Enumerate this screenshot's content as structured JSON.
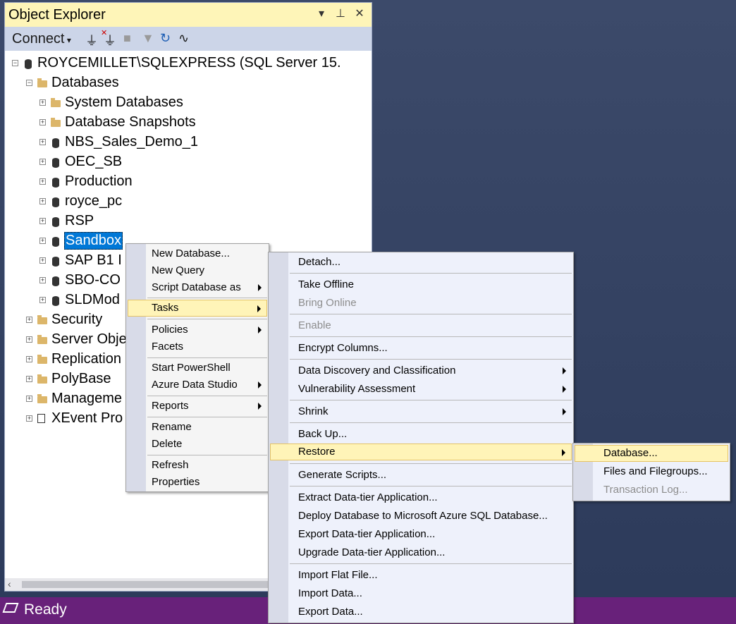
{
  "panel": {
    "title": "Object Explorer",
    "title_buttons": [
      "▾",
      "⊥",
      "✕"
    ],
    "connect_label": "Connect",
    "toolbar_icons": [
      "connect-icon",
      "disconnect-icon",
      "stop-icon",
      "filter-icon",
      "refresh-icon",
      "activity-monitor-icon"
    ]
  },
  "tree": {
    "server": "ROYCEMILLET\\SQLEXPRESS (SQL Server 15.",
    "databases": "Databases",
    "items": [
      "System Databases",
      "Database Snapshots",
      "NBS_Sales_Demo_1",
      "OEC_SB",
      "Production",
      "royce_pc",
      "RSP",
      "Sandbox",
      "SAP B1 I",
      "SBO-CO",
      "SLDMod"
    ],
    "top_items": [
      "Security",
      "Server Obje",
      "Replication",
      "PolyBase",
      "Manageme",
      "XEvent Pro"
    ]
  },
  "menu1": {
    "items": [
      {
        "label": "New Database..."
      },
      {
        "label": "New Query"
      },
      {
        "label": "Script Database as"
      },
      {
        "label": "Tasks"
      },
      {
        "label": "Policies"
      },
      {
        "label": "Facets"
      },
      {
        "label": "Start PowerShell"
      },
      {
        "label": "Azure Data Studio"
      },
      {
        "label": "Reports"
      },
      {
        "label": "Rename"
      },
      {
        "label": "Delete"
      },
      {
        "label": "Refresh"
      },
      {
        "label": "Properties"
      }
    ]
  },
  "menu2": {
    "items": [
      {
        "label": "Detach..."
      },
      {
        "label": "Take Offline"
      },
      {
        "label": "Bring Online"
      },
      {
        "label": "Enable"
      },
      {
        "label": "Encrypt Columns..."
      },
      {
        "label": "Data Discovery and Classification"
      },
      {
        "label": "Vulnerability Assessment"
      },
      {
        "label": "Shrink"
      },
      {
        "label": "Back Up..."
      },
      {
        "label": "Restore"
      },
      {
        "label": "Generate Scripts..."
      },
      {
        "label": "Extract Data-tier Application..."
      },
      {
        "label": "Deploy Database to Microsoft Azure SQL Database..."
      },
      {
        "label": "Export Data-tier Application..."
      },
      {
        "label": "Upgrade Data-tier Application..."
      },
      {
        "label": "Import Flat File..."
      },
      {
        "label": "Import Data..."
      },
      {
        "label": "Export Data..."
      }
    ]
  },
  "menu3": {
    "items": [
      {
        "label": "Database..."
      },
      {
        "label": "Files and Filegroups..."
      },
      {
        "label": "Transaction Log..."
      }
    ]
  },
  "status": {
    "text": "Ready"
  }
}
